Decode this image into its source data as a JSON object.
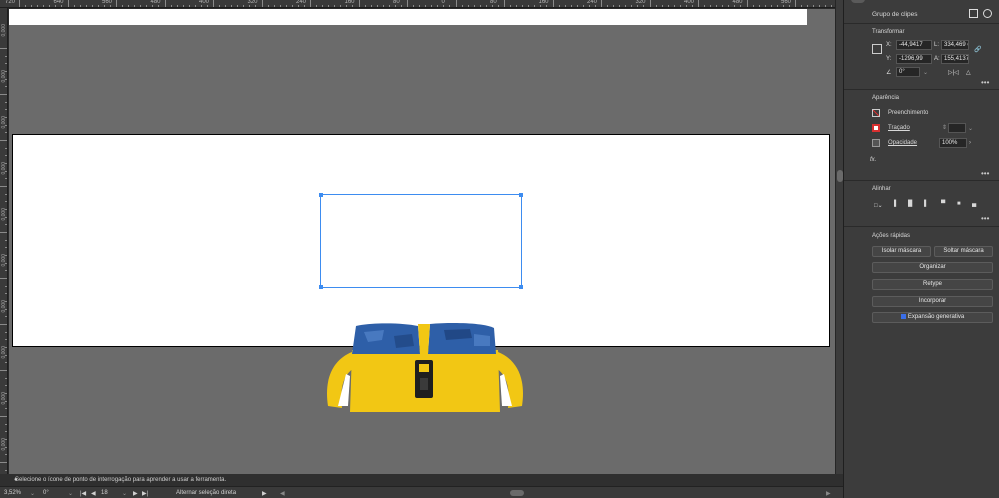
{
  "rulers": {
    "top_labels": [
      "720",
      "640",
      "560",
      "480",
      "400",
      "320",
      "240",
      "160",
      "80",
      "0",
      "80",
      "160",
      "240",
      "320",
      "400",
      "480",
      "560"
    ],
    "left_labels": [
      "0,000",
      "0,000",
      "0,000",
      "0,000",
      "0,000",
      "0,000",
      "0,000",
      "0,000",
      "0,000",
      "0,000"
    ]
  },
  "panel": {
    "title": "Grupo de clipes",
    "transform": {
      "header": "Transformar",
      "x_label": "X:",
      "x_value": "-44,9417",
      "y_label": "Y:",
      "y_value": "-1296,99",
      "l_label": "L:",
      "l_value": "334,469 c",
      "a_label": "A:",
      "a_value": "155,4137",
      "angle_value": "0°"
    },
    "appearance": {
      "header": "Aparência",
      "fill_label": "Preenchimento",
      "stroke_label": "Traçado",
      "opacity_label": "Opacidade",
      "opacity_value": "100%",
      "fx_label": "fx."
    },
    "align": {
      "header": "Alinhar"
    },
    "quick_actions": {
      "header": "Ações rápidas",
      "isolate_mask": "Isolar máscara",
      "release_mask": "Soltar máscara",
      "arrange": "Organizar",
      "retype": "Retype",
      "embed": "Incorporar",
      "generative_expand": "Expansão generativa"
    },
    "more": "•••"
  },
  "status": {
    "hint": "Selecione o ícone de ponto de interrogação para aprender a usar a ferramenta.",
    "zoom": "3,52%",
    "rotation": "0°",
    "artboard_number": "18",
    "tool_name": "Alternar seleção direta"
  },
  "colors": {
    "selection": "#3d8cf0",
    "bag_yellow": "#f2c714",
    "bag_blue": "#2e5fa8",
    "stroke_red": "#d83030",
    "gen_blue": "#3a6ee8"
  }
}
